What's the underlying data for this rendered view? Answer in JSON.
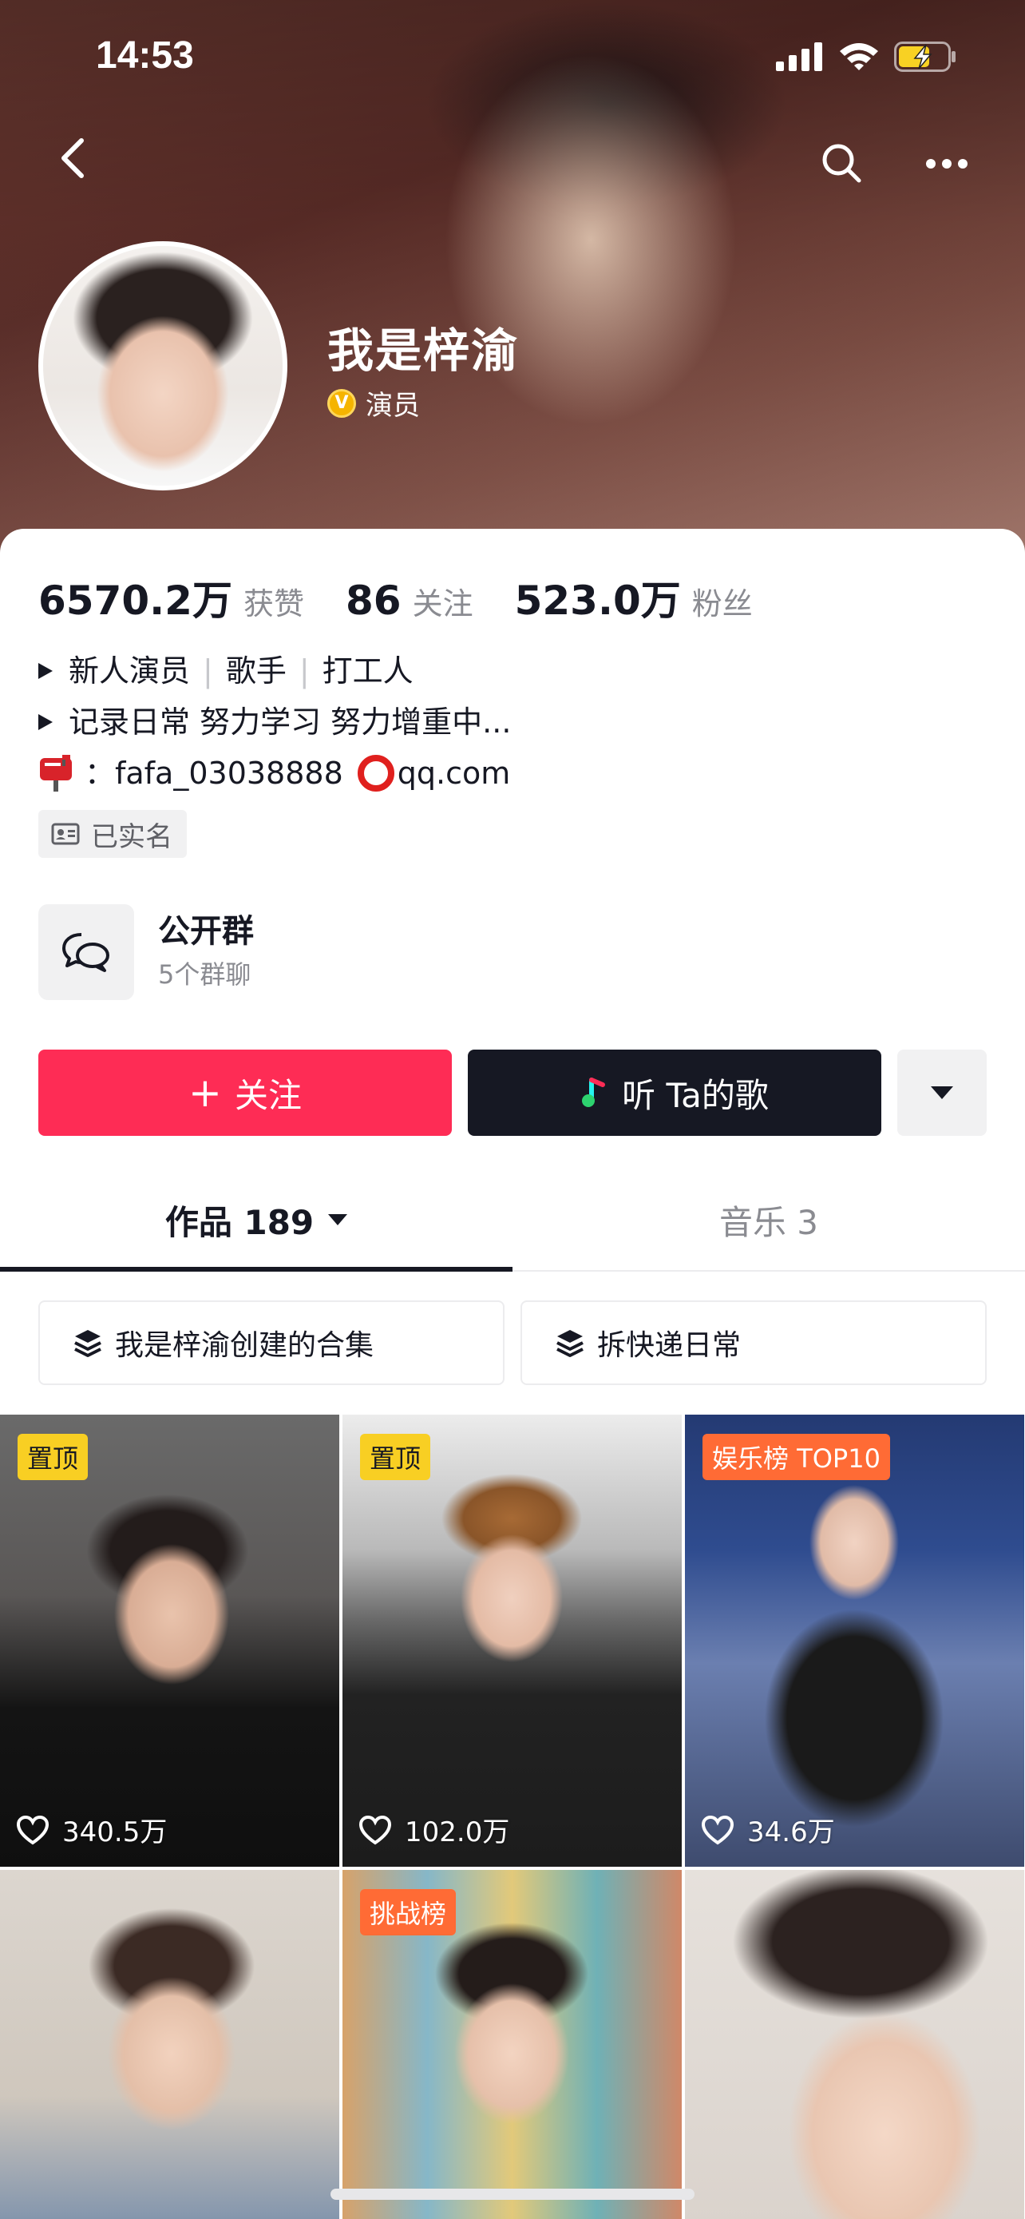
{
  "status_bar": {
    "time": "14:53",
    "icons": [
      "cellular-icon",
      "wifi-icon",
      "battery-charging-icon"
    ]
  },
  "nav": {
    "icons": [
      "back-arrow-icon",
      "search-icon",
      "more-icon"
    ]
  },
  "profile": {
    "name": "我是梓渝",
    "verified_badge": "V",
    "verified_label": "演员"
  },
  "stats": [
    {
      "value": "6570.2万",
      "label": "获赞"
    },
    {
      "value": "86",
      "label": "关注"
    },
    {
      "value": "523.0万",
      "label": "粉丝"
    }
  ],
  "bio": {
    "line1": [
      "新人演员",
      "歌手",
      "打工人"
    ],
    "line1_sep": "|",
    "line2": "记录日常 努力学习 努力增重中...",
    "contact_prefix": "：",
    "contact_user": "fafa_03038888",
    "contact_domain": "qq.com"
  },
  "realname_label": "已实名",
  "group": {
    "title": "公开群",
    "subtitle": "5个群聊"
  },
  "buttons": {
    "follow_plus": "+",
    "follow": "关注",
    "song": "听 Ta的歌"
  },
  "tabs": {
    "works_label": "作品 189",
    "music_label": "音乐 3"
  },
  "collections": [
    "我是梓渝创建的合集",
    "拆快递日常"
  ],
  "videos": [
    {
      "tag": "置顶",
      "likes": "340.5万"
    },
    {
      "tag": "置顶",
      "likes": "102.0万"
    },
    {
      "tag": "娱乐榜 TOP10",
      "likes": "34.6万"
    },
    {
      "tag": "",
      "likes": ""
    },
    {
      "tag": "挑战榜",
      "likes": ""
    },
    {
      "tag": "",
      "likes": ""
    }
  ],
  "colors": {
    "follow_button": "#fe2c55",
    "song_button": "#161823",
    "pin_tag": "#f8cf23",
    "rank_tag": "#ff6b35",
    "verified_badge": "#f5b400"
  }
}
